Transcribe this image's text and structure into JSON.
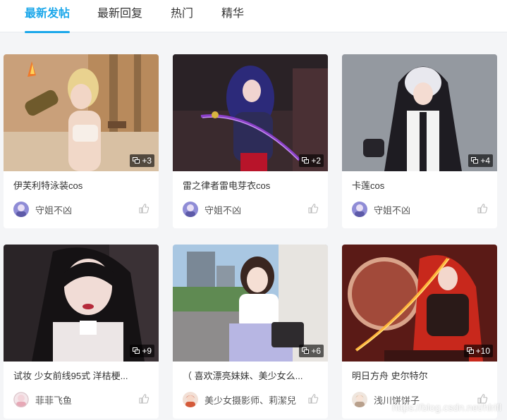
{
  "tabs": [
    {
      "label": "最新发帖",
      "active": true
    },
    {
      "label": "最新回复",
      "active": false
    },
    {
      "label": "热门",
      "active": false
    },
    {
      "label": "精华",
      "active": false
    }
  ],
  "accent_color": "#1ba7ea",
  "posts": [
    {
      "title": "伊芙利特泳装cos",
      "author": "守姐不凶",
      "image_count": "+3",
      "avatar_icon": "avatar-purple-icon",
      "like_icon": "thumb-up-icon"
    },
    {
      "title": "雷之律者雷电芽衣cos",
      "author": "守姐不凶",
      "image_count": "+2",
      "avatar_icon": "avatar-purple-icon",
      "like_icon": "thumb-up-icon"
    },
    {
      "title": "卡莲cos",
      "author": "守姐不凶",
      "image_count": "+4",
      "avatar_icon": "avatar-purple-icon",
      "like_icon": "thumb-up-icon"
    },
    {
      "title": "试妆 少女前线95式 洋桔梗...",
      "author": "菲菲飞鱼",
      "image_count": "+9",
      "avatar_icon": "avatar-pink-icon",
      "like_icon": "thumb-up-icon"
    },
    {
      "title": "（ 喜欢漂亮妹妹、美少女么...",
      "author": "美少女摄影师、莉潔兒",
      "image_count": "+6",
      "avatar_icon": "avatar-red-icon",
      "like_icon": "thumb-up-icon"
    },
    {
      "title": "明日方舟 史尔特尔",
      "author": "浅川饼饼子",
      "image_count": "+10",
      "avatar_icon": "avatar-beige-icon",
      "like_icon": "thumb-up-icon"
    }
  ],
  "watermark": "https://blog.csdn.net/hlrifl"
}
